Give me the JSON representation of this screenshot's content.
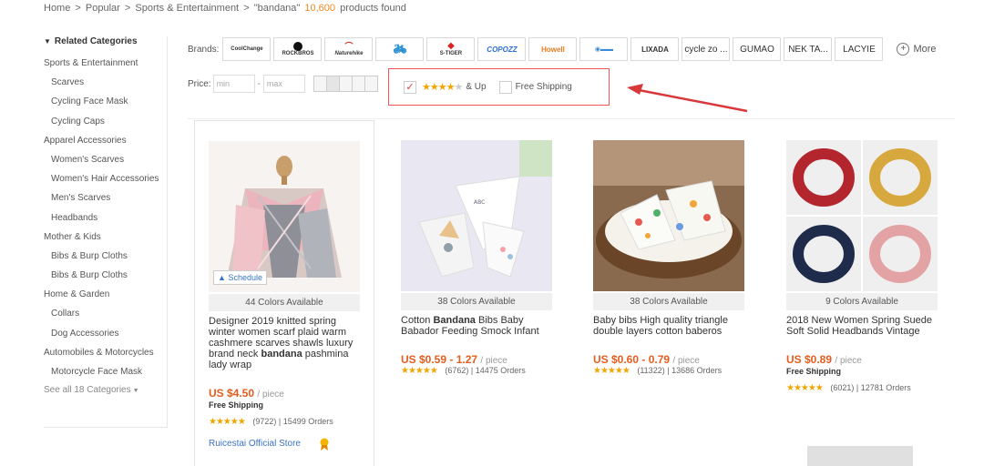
{
  "breadcrumb": {
    "home": "Home",
    "sep1": ">",
    "popular": "Popular",
    "sep2": ">",
    "category": "Sports & Entertainment",
    "sep3": ">",
    "query": "\"bandana\"",
    "count": "10,600",
    "found": "products found"
  },
  "sidebar": {
    "title": "Related Categories",
    "items": [
      {
        "label": "Sports & Entertainment",
        "sub": false
      },
      {
        "label": "Scarves",
        "sub": true
      },
      {
        "label": "Cycling Face Mask",
        "sub": true
      },
      {
        "label": "Cycling Caps",
        "sub": true
      },
      {
        "label": "Apparel Accessories",
        "sub": false
      },
      {
        "label": "Women's Scarves",
        "sub": true
      },
      {
        "label": "Women's Hair Accessories",
        "sub": true
      },
      {
        "label": "Men's Scarves",
        "sub": true
      },
      {
        "label": "Headbands",
        "sub": true
      },
      {
        "label": "Mother & Kids",
        "sub": false
      },
      {
        "label": "Bibs & Burp Cloths",
        "sub": true
      },
      {
        "label": "Bibs & Burp Cloths",
        "sub": true
      },
      {
        "label": "Home & Garden",
        "sub": false
      },
      {
        "label": "Collars",
        "sub": true
      },
      {
        "label": "Dog Accessories",
        "sub": true
      },
      {
        "label": "Automobiles & Motorcycles",
        "sub": false
      },
      {
        "label": "Motorcycle Face Mask",
        "sub": true
      }
    ],
    "see_all": "See all 18 Categories"
  },
  "filters": {
    "brands_label": "Brands:",
    "brands": [
      "CoolChange",
      "ROCKBROS",
      "Naturehike",
      "",
      "S-TIGER",
      "COPOZZ",
      "Howell",
      "",
      "LIXADA",
      "cycle zo ...",
      "GUMAO",
      "NEK TA...",
      "LACYIE"
    ],
    "more": "More",
    "price_label": "Price:",
    "min_placeholder": "min",
    "max_placeholder": "max",
    "price_dash": "-",
    "rating_up": "& Up",
    "free_shipping": "Free Shipping"
  },
  "products": [
    {
      "colors": "44 Colors Available",
      "title_pre": "Designer 2019 knitted spring winter women scarf plaid warm cashmere scarves shawls luxury brand neck ",
      "title_bold": "bandana",
      "title_post": " pashmina lady wrap",
      "price": "US $4.50",
      "unit": "/ piece",
      "free_shipping": "Free Shipping",
      "reviews": "(9722)",
      "orders_sep": "|",
      "orders": "15499 Orders",
      "store": "Ruicestai Official Store",
      "badge": "Schedule"
    },
    {
      "colors": "38 Colors Available",
      "title_pre": "Cotton ",
      "title_bold": "Bandana",
      "title_post": " Bibs Baby Babador Feeding Smock Infant",
      "price": "US $0.59 - 1.27",
      "unit": "/ piece",
      "reviews": "(6762)",
      "orders_sep": "|",
      "orders": "14475 Orders"
    },
    {
      "colors": "38 Colors Available",
      "title_pre": "Baby bibs High quality triangle double layers cotton baberos",
      "title_bold": "",
      "title_post": "",
      "price": "US $0.60 - 0.79",
      "unit": "/ piece",
      "reviews": "(11322)",
      "orders_sep": "|",
      "orders": "13686 Orders"
    },
    {
      "colors": "9 Colors Available",
      "title_pre": "2018 New Women Spring Suede Soft Solid Headbands Vintage",
      "title_bold": "",
      "title_post": "",
      "price": "US $0.89",
      "unit": "/ piece",
      "free_shipping": "Free Shipping",
      "reviews": "(6021)",
      "orders_sep": "|",
      "orders": "12781 Orders"
    }
  ],
  "colors": {
    "price": "#e45c1e",
    "star": "#f0a500",
    "link": "#3a72c4",
    "highlight_border": "#e55555",
    "count": "#f08a24"
  }
}
